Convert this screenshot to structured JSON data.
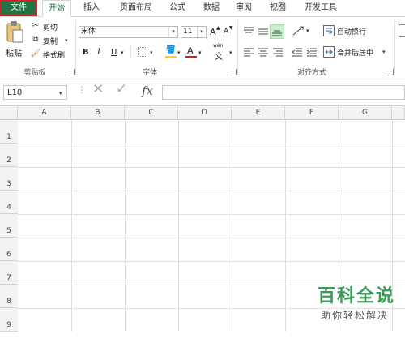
{
  "tabs": [
    "文件",
    "开始",
    "插入",
    "页面布局",
    "公式",
    "数据",
    "审阅",
    "视图",
    "开发工具"
  ],
  "clipboard": {
    "paste_label": "粘贴",
    "cut_label": "剪切",
    "copy_label": "复制",
    "format_painter_label": "格式刷",
    "group_label": "剪贴板"
  },
  "font": {
    "font_name": "宋体",
    "font_size": "11",
    "bold": "B",
    "italic": "I",
    "underline": "U",
    "grow": "A",
    "shrink": "A",
    "font_color_letter": "A",
    "wen_label": "wén",
    "wen_char": "文",
    "group_label": "字体"
  },
  "alignment": {
    "wrap_text_label": "自动换行",
    "merge_center_label": "合并后居中",
    "group_label": "对齐方式"
  },
  "formula_bar": {
    "name_box": "L10",
    "fx": "fx",
    "formula_value": ""
  },
  "grid": {
    "columns": [
      "A",
      "B",
      "C",
      "D",
      "E",
      "F",
      "G"
    ],
    "rows": [
      "1",
      "2",
      "3",
      "4",
      "5",
      "6",
      "7",
      "8",
      "9"
    ]
  },
  "watermark": {
    "title": "百科全说",
    "subtitle": "助你轻松解决"
  },
  "colors": {
    "accent": "#217346",
    "file_outline": "#d42020",
    "font_color": "#d42020",
    "fill_color": "#ffd400",
    "watermark": "#3a9b57"
  }
}
